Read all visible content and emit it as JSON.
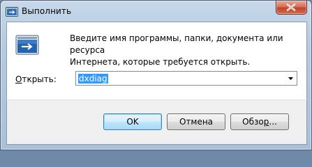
{
  "window": {
    "title": "Выполнить",
    "title_icon": "run-icon",
    "close_icon": "close-icon"
  },
  "content": {
    "app_icon": "run-dialog-icon",
    "description_line1": "Введите имя программы, папки, документа или ресурса",
    "description_line2": "Интернета, которые требуется открыть.",
    "open_label_accel": "О",
    "open_label_rest": "ткрыть:",
    "open_value": "dxdiag",
    "dropdown_icon": "chevron-down-icon"
  },
  "buttons": {
    "ok": "OK",
    "cancel": "Отмена",
    "browse_prefix": "Обзо",
    "browse_accel": "р",
    "browse_suffix": "..."
  },
  "colors": {
    "selection": "#3399ff",
    "ok_border": "#3c7fb1",
    "close_red": "#c2422b"
  }
}
